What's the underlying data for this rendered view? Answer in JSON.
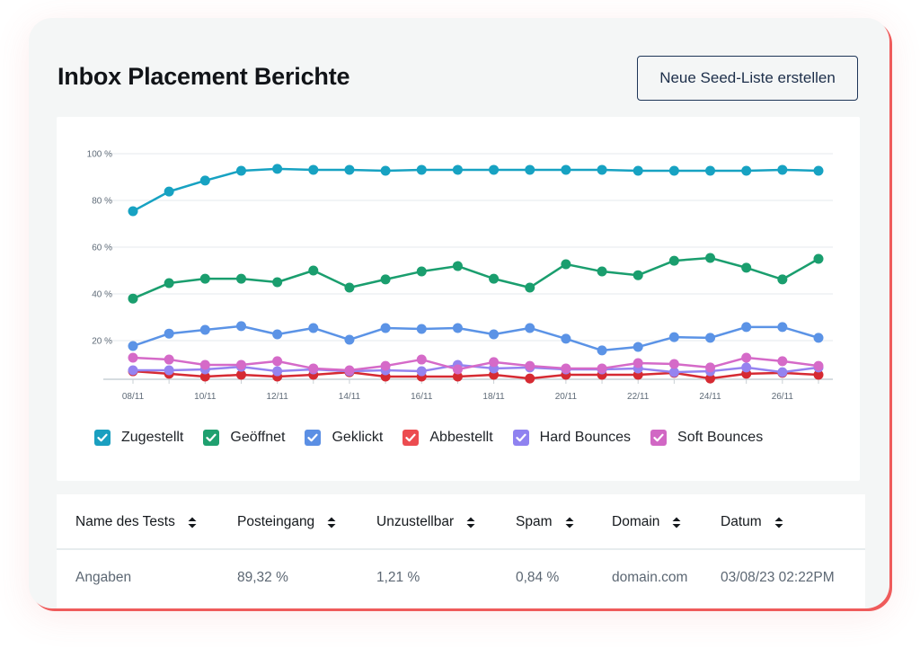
{
  "header": {
    "title": "Inbox Placement Berichte",
    "new_seed_list_button": "Neue Seed-Liste erstellen"
  },
  "chart_data": {
    "type": "line",
    "title": "",
    "xlabel": "",
    "ylabel": "",
    "ylim": [
      0,
      100
    ],
    "y_ticks": [
      20,
      40,
      60,
      80,
      100
    ],
    "y_tick_labels": [
      "20 %",
      "40 %",
      "60 %",
      "80 %",
      "100 %"
    ],
    "x": [
      "08/11",
      "09/11",
      "10/11",
      "11/11",
      "12/11",
      "13/11",
      "14/11",
      "15/11",
      "16/11",
      "17/11",
      "18/11",
      "19/11",
      "20/11",
      "21/11",
      "22/11",
      "23/11",
      "24/11",
      "25/11",
      "26/11",
      "27/11"
    ],
    "x_tick_labels": [
      "08/11",
      "10/11",
      "12/11",
      "14/11",
      "16/11",
      "18/11",
      "20/11",
      "22/11",
      "24/11",
      "26/11"
    ],
    "grid": true,
    "legend_position": "bottom-left",
    "series": [
      {
        "name": "Zugestellt",
        "color": "#17a2c2",
        "values": [
          75.4,
          83.8,
          88.5,
          92.7,
          93.5,
          93.1,
          93.1,
          92.7,
          93.1,
          93.1,
          93.1,
          93.1,
          93.1,
          93.1,
          92.7,
          92.7,
          92.7,
          92.7,
          93.1,
          92.7
        ]
      },
      {
        "name": "Geöffnet",
        "color": "#1a9e6e",
        "values": [
          38.0,
          44.6,
          46.5,
          46.5,
          45.0,
          50.0,
          42.7,
          46.2,
          49.6,
          51.9,
          46.5,
          42.7,
          52.7,
          49.6,
          48.0,
          54.2,
          55.4,
          51.2,
          46.2,
          55.0
        ]
      },
      {
        "name": "Geklickt",
        "color": "#5b93e6",
        "values": [
          17.7,
          23.0,
          24.6,
          26.2,
          22.7,
          25.4,
          20.4,
          25.4,
          25.0,
          25.4,
          22.7,
          25.4,
          20.8,
          15.8,
          17.3,
          21.5,
          21.2,
          25.8,
          25.8,
          21.2
        ]
      },
      {
        "name": "Abbestellt",
        "color": "#d62a32",
        "values": [
          6.9,
          5.8,
          4.6,
          5.4,
          4.6,
          5.4,
          6.5,
          4.6,
          4.6,
          4.6,
          5.4,
          3.8,
          5.4,
          5.4,
          5.4,
          6.2,
          3.8,
          5.8,
          6.2,
          5.4
        ]
      },
      {
        "name": "Hard Bounces",
        "color": "#9583f0",
        "values": [
          7.3,
          7.3,
          7.7,
          8.8,
          6.9,
          7.7,
          6.9,
          7.3,
          6.9,
          9.6,
          8.1,
          8.5,
          7.7,
          7.7,
          8.1,
          6.5,
          6.9,
          8.5,
          6.5,
          8.5
        ]
      },
      {
        "name": "Soft Bounces",
        "color": "#d56ac8",
        "values": [
          12.7,
          11.9,
          9.6,
          9.6,
          11.2,
          8.1,
          7.3,
          9.2,
          11.9,
          7.7,
          10.8,
          9.2,
          8.1,
          8.1,
          10.4,
          10.0,
          8.5,
          12.7,
          11.2,
          9.2
        ]
      }
    ]
  },
  "legend": {
    "items": [
      {
        "label": "Zugestellt",
        "color": "#17a2c2",
        "box_color": "#1a9fc0",
        "checked": true
      },
      {
        "label": "Geöffnet",
        "color": "#1a9e6e",
        "box_color": "#1fa06f",
        "checked": true
      },
      {
        "label": "Geklickt",
        "color": "#5b93e6",
        "box_color": "#5b8fe4",
        "checked": true
      },
      {
        "label": "Abbestellt",
        "color": "#d62a32",
        "box_color": "#ec4c50",
        "checked": true
      },
      {
        "label": "Hard Bounces",
        "color": "#9583f0",
        "box_color": "#8f82f0",
        "checked": true
      },
      {
        "label": "Soft Bounces",
        "color": "#d56ac8",
        "box_color": "#d167c4",
        "checked": true
      }
    ]
  },
  "table": {
    "columns": [
      "Name des Tests",
      "Posteingang",
      "Unzustellbar",
      "Spam",
      "Domain",
      "Datum"
    ],
    "rows": [
      [
        "Angaben",
        "89,32 %",
        "1,21 %",
        "0,84 %",
        "domain.com",
        "03/08/23 02:22PM"
      ]
    ]
  }
}
